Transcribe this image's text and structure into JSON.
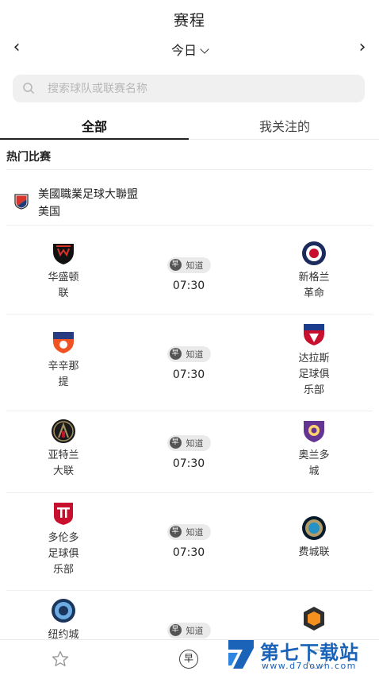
{
  "header": {
    "title": "赛程",
    "date_label": "今日",
    "prev_icon": "chevron-left-icon",
    "next_icon": "chevron-right-icon"
  },
  "search": {
    "placeholder": "搜索球队或联赛名称",
    "value": ""
  },
  "tabs": [
    {
      "label": "全部",
      "active": true
    },
    {
      "label": "我关注的",
      "active": false
    }
  ],
  "section_title": "热门比赛",
  "league": {
    "name": "美國職業足球大聯盟",
    "country": "美国"
  },
  "matches": [
    {
      "home": "华盛顿联",
      "away": "新格兰革命",
      "badge": "知道",
      "time": "07:30"
    },
    {
      "home": "辛辛那提",
      "away": "达拉斯足球俱乐部",
      "badge": "知道",
      "time": "07:30"
    },
    {
      "home": "亚特兰大联",
      "away": "奥兰多城",
      "badge": "知道",
      "time": "07:30"
    },
    {
      "home": "多伦多足球俱乐部",
      "away": "费城联",
      "badge": "知道",
      "time": "07:30"
    },
    {
      "home": "纽约城",
      "away": "",
      "badge": "知道",
      "time": ""
    }
  ],
  "badge_glyph": "早",
  "tabbar": {
    "items": [
      "star-icon",
      "zao-icon",
      "circle-icon"
    ],
    "center_glyph": "早"
  },
  "watermark": {
    "title": "第七下载站",
    "url": "www.d7down.com"
  },
  "colors": {
    "accent": "#1a63b8",
    "badge_bg": "#eaeaea",
    "search_bg": "#f0f0f0"
  }
}
